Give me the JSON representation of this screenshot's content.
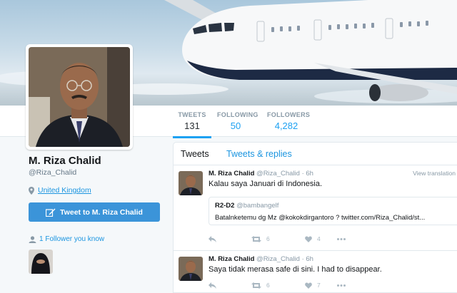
{
  "profile": {
    "name": "M. Riza Chalid",
    "handle": "@Riza_Chalid",
    "location": "United Kingdom",
    "tweet_to_label": "Tweet to M. Riza Chalid",
    "followers_you_know": "1 Follower you know"
  },
  "stats": [
    {
      "label": "TWEETS",
      "value": "131"
    },
    {
      "label": "FOLLOWING",
      "value": "50"
    },
    {
      "label": "FOLLOWERS",
      "value": "4,282"
    }
  ],
  "timeline": {
    "tabs": [
      "Tweets",
      "Tweets & replies"
    ],
    "tweets": [
      {
        "name": "M. Riza Chalid",
        "handle": "@Riza_Chalid",
        "time": "· 6h",
        "text": "Kalau saya Januari di Indonesia.",
        "view_translation": "View translation",
        "quote": {
          "name": "R2-D2",
          "handle": "@bambangelf",
          "text": "Batalnketemu dg Mz @kokokdirgantoro ?  twitter.com/Riza_Chalid/st..."
        },
        "retweets": "6",
        "likes": "4"
      },
      {
        "name": "M. Riza Chalid",
        "handle": "@Riza_Chalid",
        "time": "· 6h",
        "text": "Saya tidak merasa safe di sini. I had to disappear.",
        "retweets": "6",
        "likes": "7"
      }
    ]
  },
  "colors": {
    "accent": "#1da1f2",
    "button": "#3b94d9",
    "link": "#1b95e0"
  },
  "icons": [
    "location-pin-icon",
    "tweet-compose-icon",
    "person-icon",
    "reply-icon",
    "retweet-icon",
    "like-icon",
    "more-icon"
  ]
}
